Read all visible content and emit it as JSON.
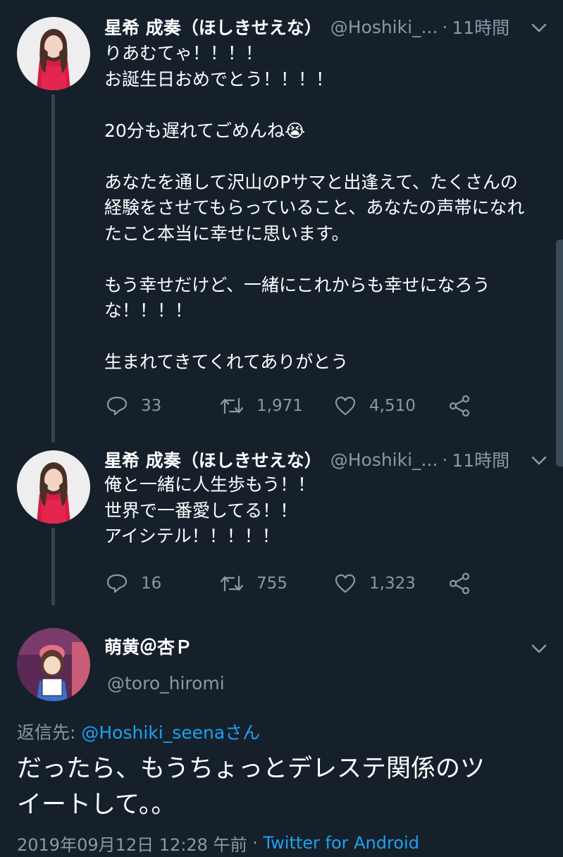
{
  "tweets": [
    {
      "name": "星希 成奏（ほしきせえな）",
      "handle": "@Hoshiki_...",
      "dot": "·",
      "time": "11時間",
      "text": "りあむてゃ！！！！\nお誕生日おめでとう！！！！\n\n20分も遅れてごめんね😭\n\nあなたを通して沢山のPサマと出逢えて、たくさんの\n経験をさせてもらっていること、あなたの声帯になれ\nたこと本当に幸せに思います。\n\nもう幸せだけど、一緒にこれからも幸せになろう\nな！！！！\n\n生まれてきてくれてありがとう",
      "replies": "33",
      "retweets": "1,971",
      "likes": "4,510"
    },
    {
      "name": "星希 成奏（ほしきせえな）",
      "handle": "@Hoshiki_...",
      "dot": "·",
      "time": "11時間",
      "text": "俺と一緒に人生歩もう！！\n世界で一番愛してる！！\nアイシテル！！！！！",
      "replies": "16",
      "retweets": "755",
      "likes": "1,323"
    }
  ],
  "focused": {
    "name": "萌黄＠杏Ｐ",
    "handle": "@toro_hiromi",
    "reply_prefix": "返信先: ",
    "reply_to": "@Hoshiki_seenaさん",
    "text": "だったら、もうちょっとデレステ関係のツ\nイートして。。",
    "date": "2019年09月12日 12:28 午前",
    "dot": " · ",
    "source": "Twitter for Android"
  },
  "colors": {
    "background": "#15202b",
    "secondary_text": "#8899a6",
    "link": "#1da1f2",
    "thread_line": "#38444d"
  },
  "icons": [
    "chevron-down-icon",
    "reply-icon",
    "retweet-icon",
    "like-icon",
    "share-icon"
  ]
}
